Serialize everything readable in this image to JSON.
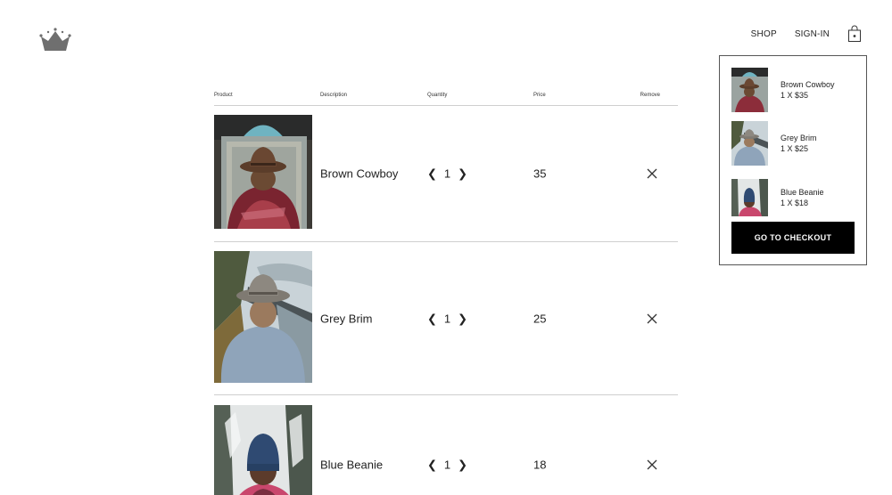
{
  "header": {
    "logo": "crown-icon",
    "nav": {
      "shop": "SHOP",
      "signin": "SIGN-IN",
      "bag": "shopping-bag-icon"
    }
  },
  "cart": {
    "columns": {
      "product": "Product",
      "description": "Description",
      "quantity": "Quantity",
      "price": "Price",
      "remove": "Remove"
    },
    "items": [
      {
        "name": "Brown Cowboy",
        "quantity": "1",
        "price": "35",
        "prev": "❮",
        "next": "❯",
        "remove_icon": "close-icon"
      },
      {
        "name": "Grey Brim",
        "quantity": "1",
        "price": "25",
        "prev": "❮",
        "next": "❯",
        "remove_icon": "close-icon"
      },
      {
        "name": "Blue Beanie",
        "quantity": "1",
        "price": "18",
        "prev": "❮",
        "next": "❯",
        "remove_icon": "close-icon"
      }
    ]
  },
  "minicart": {
    "items": [
      {
        "name": "Brown Cowboy",
        "detail": "1 X $35"
      },
      {
        "name": "Grey Brim",
        "detail": "1 X $25"
      },
      {
        "name": "Blue Beanie",
        "detail": "1 X $18"
      }
    ],
    "checkout_label": "GO TO CHECKOUT"
  },
  "colors": {
    "accent": "#000000",
    "divider": "#cfcfcf",
    "logo": "#6f6f6f"
  }
}
